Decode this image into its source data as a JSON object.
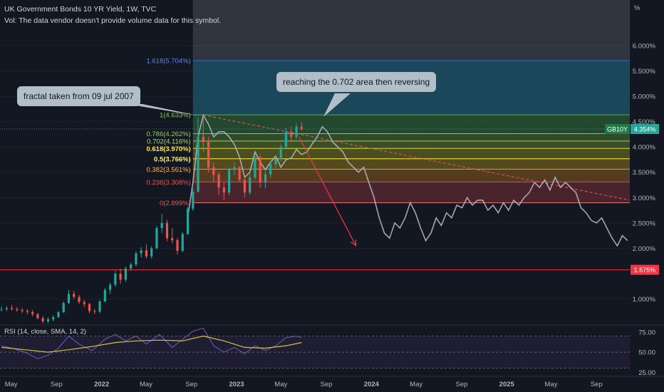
{
  "header": {
    "title": "UK Government Bonds 10 YR Yield, 1W, TVC",
    "volume_note": "Vol: The data vendor doesn't provide volume data for this symbol."
  },
  "callouts": {
    "fractal": "fractal taken from 09 jul 2007",
    "reaching": "reaching the 0.702 area then reversing"
  },
  "colors": {
    "background": "#131722",
    "up_candle": "#26a69a",
    "down_candle": "#ef5350",
    "projection": "#b2b5be",
    "rsi_line": "#7e57c2",
    "rsi_ma": "#d4c43a"
  },
  "chart_data": {
    "type": "candlestick",
    "symbol_badge": "GB10Y",
    "price_axis": {
      "unit": "%",
      "ticks": [
        "6.000%",
        "5.500%",
        "5.000%",
        "4.500%",
        "4.000%",
        "3.500%",
        "3.000%",
        "2.500%",
        "2.000%",
        "1.000%"
      ],
      "tick_values": [
        6.0,
        5.5,
        5.0,
        4.5,
        4.0,
        3.5,
        3.0,
        2.5,
        2.0,
        1.0
      ],
      "range": [
        0.5,
        6.9
      ]
    },
    "time_axis": {
      "labels": [
        "May",
        "Sep",
        "2022",
        "May",
        "Sep",
        "2023",
        "May",
        "Sep",
        "2024",
        "May",
        "Sep",
        "2025",
        "May",
        "Sep"
      ],
      "range": [
        "2021-04-01",
        "2025-11-30"
      ]
    },
    "current_price": {
      "label": "4.354%",
      "value": 4.354
    },
    "horizontal_line": {
      "label": "1.575%",
      "value": 1.575
    },
    "fib_levels": [
      {
        "label": "1.618(5.704%)",
        "ratio": 1.618,
        "value": 5.704,
        "color": "#2962ff",
        "text_color": "#5b86e5",
        "fill": "#1e5a6e"
      },
      {
        "label": "1(4.633%)",
        "ratio": 1,
        "value": 4.633,
        "color": "#4caf50",
        "text_color": "#8bc34a",
        "fill": "#2a5a34"
      },
      {
        "label": "0.786(4.262%)",
        "ratio": 0.786,
        "value": 4.262,
        "color": "#81c784",
        "text_color": "#9ccc65",
        "fill": "#3a5f2c"
      },
      {
        "label": "0.702(4.116%)",
        "ratio": 0.702,
        "value": 4.116,
        "color": "#9ccc65",
        "text_color": "#aed581",
        "fill": "#4d6226"
      },
      {
        "label": "0.618(3.970%)",
        "ratio": 0.618,
        "value": 3.97,
        "color": "#cddc39",
        "text_color": "#ffeb3b",
        "fill": "#5f6220"
      },
      {
        "label": "0.5(3.766%)",
        "ratio": 0.5,
        "value": 3.766,
        "color": "#ffeb3b",
        "text_color": "#fff176",
        "fill": "#6a5e1e"
      },
      {
        "label": "0.382(3.561%)",
        "ratio": 0.382,
        "value": 3.561,
        "color": "#ff9800",
        "text_color": "#ffb74d",
        "fill": "#6b4a22"
      },
      {
        "label": "0.236(3.308%)",
        "ratio": 0.236,
        "value": 3.308,
        "color": "#f44336",
        "text_color": "#ef5350",
        "fill": "#5e2a30"
      },
      {
        "label": "0(2.899%)",
        "ratio": 0,
        "value": 2.899,
        "color": "#e57373",
        "text_color": "#ef5350",
        "fill": ""
      }
    ],
    "fib_range": [
      "2022-09-05",
      "2025-11-30"
    ],
    "candles": [
      {
        "t": "2021-04-05",
        "o": 0.8,
        "h": 0.85,
        "l": 0.75,
        "c": 0.8
      },
      {
        "t": "2021-04-19",
        "o": 0.8,
        "h": 0.86,
        "l": 0.76,
        "c": 0.82
      },
      {
        "t": "2021-05-03",
        "o": 0.82,
        "h": 0.88,
        "l": 0.77,
        "c": 0.8
      },
      {
        "t": "2021-05-17",
        "o": 0.8,
        "h": 0.84,
        "l": 0.75,
        "c": 0.78
      },
      {
        "t": "2021-05-31",
        "o": 0.78,
        "h": 0.82,
        "l": 0.72,
        "c": 0.76
      },
      {
        "t": "2021-06-14",
        "o": 0.76,
        "h": 0.8,
        "l": 0.7,
        "c": 0.74
      },
      {
        "t": "2021-06-28",
        "o": 0.74,
        "h": 0.78,
        "l": 0.66,
        "c": 0.7
      },
      {
        "t": "2021-07-12",
        "o": 0.7,
        "h": 0.72,
        "l": 0.6,
        "c": 0.62
      },
      {
        "t": "2021-07-26",
        "o": 0.62,
        "h": 0.66,
        "l": 0.52,
        "c": 0.56
      },
      {
        "t": "2021-08-09",
        "o": 0.56,
        "h": 0.64,
        "l": 0.52,
        "c": 0.6
      },
      {
        "t": "2021-08-23",
        "o": 0.6,
        "h": 0.68,
        "l": 0.56,
        "c": 0.64
      },
      {
        "t": "2021-09-06",
        "o": 0.64,
        "h": 0.76,
        "l": 0.62,
        "c": 0.74
      },
      {
        "t": "2021-09-20",
        "o": 0.74,
        "h": 0.95,
        "l": 0.72,
        "c": 0.92
      },
      {
        "t": "2021-10-04",
        "o": 0.92,
        "h": 1.18,
        "l": 0.9,
        "c": 1.1
      },
      {
        "t": "2021-10-18",
        "o": 1.1,
        "h": 1.16,
        "l": 1.0,
        "c": 1.04
      },
      {
        "t": "2021-11-01",
        "o": 1.04,
        "h": 1.08,
        "l": 0.9,
        "c": 0.94
      },
      {
        "t": "2021-11-15",
        "o": 0.94,
        "h": 0.98,
        "l": 0.84,
        "c": 0.9
      },
      {
        "t": "2021-11-29",
        "o": 0.9,
        "h": 0.92,
        "l": 0.72,
        "c": 0.76
      },
      {
        "t": "2021-12-13",
        "o": 0.76,
        "h": 0.8,
        "l": 0.7,
        "c": 0.75
      },
      {
        "t": "2021-12-27",
        "o": 0.75,
        "h": 0.98,
        "l": 0.72,
        "c": 0.95
      },
      {
        "t": "2022-01-10",
        "o": 0.95,
        "h": 1.22,
        "l": 0.94,
        "c": 1.18
      },
      {
        "t": "2022-01-24",
        "o": 1.18,
        "h": 1.32,
        "l": 1.1,
        "c": 1.28
      },
      {
        "t": "2022-02-07",
        "o": 1.28,
        "h": 1.56,
        "l": 1.24,
        "c": 1.5
      },
      {
        "t": "2022-02-21",
        "o": 1.5,
        "h": 1.6,
        "l": 1.3,
        "c": 1.38
      },
      {
        "t": "2022-03-07",
        "o": 1.38,
        "h": 1.64,
        "l": 1.34,
        "c": 1.6
      },
      {
        "t": "2022-03-21",
        "o": 1.6,
        "h": 1.72,
        "l": 1.56,
        "c": 1.68
      },
      {
        "t": "2022-04-04",
        "o": 1.68,
        "h": 1.94,
        "l": 1.64,
        "c": 1.9
      },
      {
        "t": "2022-04-18",
        "o": 1.9,
        "h": 2.02,
        "l": 1.82,
        "c": 1.96
      },
      {
        "t": "2022-05-02",
        "o": 1.96,
        "h": 2.08,
        "l": 1.8,
        "c": 1.84
      },
      {
        "t": "2022-05-16",
        "o": 1.84,
        "h": 2.04,
        "l": 1.8,
        "c": 2.0
      },
      {
        "t": "2022-05-30",
        "o": 2.0,
        "h": 2.44,
        "l": 1.98,
        "c": 2.4
      },
      {
        "t": "2022-06-13",
        "o": 2.4,
        "h": 2.68,
        "l": 2.3,
        "c": 2.5
      },
      {
        "t": "2022-06-27",
        "o": 2.5,
        "h": 2.56,
        "l": 2.14,
        "c": 2.2
      },
      {
        "t": "2022-07-11",
        "o": 2.2,
        "h": 2.4,
        "l": 2.1,
        "c": 2.16
      },
      {
        "t": "2022-07-25",
        "o": 2.16,
        "h": 2.2,
        "l": 1.88,
        "c": 1.95
      },
      {
        "t": "2022-08-08",
        "o": 1.95,
        "h": 2.32,
        "l": 1.92,
        "c": 2.28
      },
      {
        "t": "2022-08-22",
        "o": 2.28,
        "h": 2.82,
        "l": 2.26,
        "c": 2.78
      },
      {
        "t": "2022-09-05",
        "o": 2.78,
        "h": 3.18,
        "l": 2.74,
        "c": 3.12
      },
      {
        "t": "2022-09-19",
        "o": 3.12,
        "h": 4.58,
        "l": 3.1,
        "c": 4.2
      },
      {
        "t": "2022-10-03",
        "o": 4.2,
        "h": 4.63,
        "l": 3.9,
        "c": 4.1
      },
      {
        "t": "2022-10-17",
        "o": 4.1,
        "h": 4.2,
        "l": 3.5,
        "c": 3.6
      },
      {
        "t": "2022-10-31",
        "o": 3.6,
        "h": 3.7,
        "l": 3.3,
        "c": 3.45
      },
      {
        "t": "2022-11-14",
        "o": 3.45,
        "h": 3.5,
        "l": 3.05,
        "c": 3.2
      },
      {
        "t": "2022-11-28",
        "o": 3.2,
        "h": 3.3,
        "l": 2.95,
        "c": 3.1
      },
      {
        "t": "2022-12-12",
        "o": 3.1,
        "h": 3.6,
        "l": 3.05,
        "c": 3.55
      },
      {
        "t": "2022-12-26",
        "o": 3.55,
        "h": 3.7,
        "l": 3.45,
        "c": 3.6
      },
      {
        "t": "2023-01-09",
        "o": 3.6,
        "h": 3.62,
        "l": 3.3,
        "c": 3.35
      },
      {
        "t": "2023-01-23",
        "o": 3.35,
        "h": 3.42,
        "l": 3.0,
        "c": 3.1
      },
      {
        "t": "2023-02-06",
        "o": 3.1,
        "h": 3.5,
        "l": 3.05,
        "c": 3.4
      },
      {
        "t": "2023-02-20",
        "o": 3.4,
        "h": 3.82,
        "l": 3.36,
        "c": 3.8
      },
      {
        "t": "2023-03-06",
        "o": 3.8,
        "h": 3.84,
        "l": 3.2,
        "c": 3.3
      },
      {
        "t": "2023-03-20",
        "o": 3.3,
        "h": 3.52,
        "l": 3.18,
        "c": 3.46
      },
      {
        "t": "2023-04-03",
        "o": 3.46,
        "h": 3.72,
        "l": 3.4,
        "c": 3.66
      },
      {
        "t": "2023-04-17",
        "o": 3.66,
        "h": 3.82,
        "l": 3.6,
        "c": 3.76
      },
      {
        "t": "2023-05-01",
        "o": 3.76,
        "h": 4.05,
        "l": 3.72,
        "c": 4.0
      },
      {
        "t": "2023-05-15",
        "o": 4.0,
        "h": 4.38,
        "l": 3.98,
        "c": 4.3
      },
      {
        "t": "2023-05-29",
        "o": 4.3,
        "h": 4.4,
        "l": 4.1,
        "c": 4.2
      },
      {
        "t": "2023-06-12",
        "o": 4.2,
        "h": 4.46,
        "l": 4.16,
        "c": 4.4
      },
      {
        "t": "2023-06-26",
        "o": 4.4,
        "h": 4.48,
        "l": 4.32,
        "c": 4.354
      }
    ],
    "fractal_projection": [
      {
        "t": "2022-08-22",
        "v": 2.6
      },
      {
        "t": "2022-09-05",
        "v": 3.3
      },
      {
        "t": "2022-09-19",
        "v": 4.2
      },
      {
        "t": "2022-10-03",
        "v": 4.63
      },
      {
        "t": "2022-10-17",
        "v": 4.45
      },
      {
        "t": "2022-10-31",
        "v": 4.2
      },
      {
        "t": "2022-11-14",
        "v": 4.3
      },
      {
        "t": "2022-11-28",
        "v": 4.3
      },
      {
        "t": "2022-12-12",
        "v": 4.2
      },
      {
        "t": "2022-12-26",
        "v": 4.05
      },
      {
        "t": "2023-01-09",
        "v": 3.8
      },
      {
        "t": "2023-01-23",
        "v": 3.4
      },
      {
        "t": "2023-02-06",
        "v": 3.5
      },
      {
        "t": "2023-02-20",
        "v": 3.9
      },
      {
        "t": "2023-03-06",
        "v": 3.7
      },
      {
        "t": "2023-03-20",
        "v": 3.55
      },
      {
        "t": "2023-04-03",
        "v": 3.7
      },
      {
        "t": "2023-04-17",
        "v": 3.82
      },
      {
        "t": "2023-05-01",
        "v": 3.6
      },
      {
        "t": "2023-05-15",
        "v": 3.75
      },
      {
        "t": "2023-05-29",
        "v": 3.78
      },
      {
        "t": "2023-06-12",
        "v": 3.95
      },
      {
        "t": "2023-06-26",
        "v": 3.85
      },
      {
        "t": "2023-07-10",
        "v": 3.9
      },
      {
        "t": "2023-07-24",
        "v": 4.05
      },
      {
        "t": "2023-08-07",
        "v": 4.2
      },
      {
        "t": "2023-08-21",
        "v": 4.4
      },
      {
        "t": "2023-09-04",
        "v": 4.3
      },
      {
        "t": "2023-09-18",
        "v": 4.1
      },
      {
        "t": "2023-10-02",
        "v": 4.0
      },
      {
        "t": "2023-10-16",
        "v": 3.9
      },
      {
        "t": "2023-10-30",
        "v": 3.7
      },
      {
        "t": "2023-11-13",
        "v": 3.6
      },
      {
        "t": "2023-11-27",
        "v": 3.5
      },
      {
        "t": "2023-12-11",
        "v": 3.6
      },
      {
        "t": "2023-12-25",
        "v": 3.3
      },
      {
        "t": "2024-01-08",
        "v": 3.0
      },
      {
        "t": "2024-01-22",
        "v": 2.6
      },
      {
        "t": "2024-02-05",
        "v": 2.3
      },
      {
        "t": "2024-02-19",
        "v": 2.2
      },
      {
        "t": "2024-03-04",
        "v": 2.5
      },
      {
        "t": "2024-03-18",
        "v": 2.4
      },
      {
        "t": "2024-04-01",
        "v": 2.6
      },
      {
        "t": "2024-04-15",
        "v": 2.9
      },
      {
        "t": "2024-04-29",
        "v": 2.7
      },
      {
        "t": "2024-05-13",
        "v": 2.4
      },
      {
        "t": "2024-05-27",
        "v": 2.15
      },
      {
        "t": "2024-06-10",
        "v": 2.3
      },
      {
        "t": "2024-06-24",
        "v": 2.6
      },
      {
        "t": "2024-07-08",
        "v": 2.45
      },
      {
        "t": "2024-07-22",
        "v": 2.7
      },
      {
        "t": "2024-08-05",
        "v": 2.6
      },
      {
        "t": "2024-08-19",
        "v": 2.85
      },
      {
        "t": "2024-09-02",
        "v": 2.8
      },
      {
        "t": "2024-09-16",
        "v": 3.0
      },
      {
        "t": "2024-09-30",
        "v": 2.85
      },
      {
        "t": "2024-10-14",
        "v": 2.95
      },
      {
        "t": "2024-10-28",
        "v": 2.95
      },
      {
        "t": "2024-11-11",
        "v": 2.75
      },
      {
        "t": "2024-11-25",
        "v": 2.85
      },
      {
        "t": "2024-12-09",
        "v": 2.7
      },
      {
        "t": "2024-12-23",
        "v": 2.9
      },
      {
        "t": "2025-01-06",
        "v": 2.75
      },
      {
        "t": "2025-01-20",
        "v": 2.95
      },
      {
        "t": "2025-02-03",
        "v": 2.85
      },
      {
        "t": "2025-02-17",
        "v": 3.0
      },
      {
        "t": "2025-03-03",
        "v": 3.1
      },
      {
        "t": "2025-03-17",
        "v": 3.3
      },
      {
        "t": "2025-03-31",
        "v": 3.2
      },
      {
        "t": "2025-04-14",
        "v": 3.35
      },
      {
        "t": "2025-04-28",
        "v": 3.15
      },
      {
        "t": "2025-05-12",
        "v": 3.4
      },
      {
        "t": "2025-05-26",
        "v": 3.2
      },
      {
        "t": "2025-06-09",
        "v": 3.3
      },
      {
        "t": "2025-06-23",
        "v": 3.2
      },
      {
        "t": "2025-07-07",
        "v": 3.1
      },
      {
        "t": "2025-07-21",
        "v": 2.8
      },
      {
        "t": "2025-08-04",
        "v": 2.7
      },
      {
        "t": "2025-08-18",
        "v": 2.55
      },
      {
        "t": "2025-09-01",
        "v": 2.5
      },
      {
        "t": "2025-09-15",
        "v": 2.6
      },
      {
        "t": "2025-09-29",
        "v": 2.4
      },
      {
        "t": "2025-10-13",
        "v": 2.2
      },
      {
        "t": "2025-10-27",
        "v": 2.05
      },
      {
        "t": "2025-11-10",
        "v": 2.25
      },
      {
        "t": "2025-11-24",
        "v": 2.15
      }
    ],
    "trendline": [
      {
        "t": "2022-10-03",
        "v": 4.63
      },
      {
        "t": "2025-11-30",
        "v": 2.95
      }
    ],
    "arrow": [
      {
        "t": "2023-06-19",
        "v": 4.2
      },
      {
        "t": "2023-11-20",
        "v": 2.05
      }
    ],
    "rsi": {
      "label": "RSI (14, close, SMA, 14, 2)",
      "ticks": [
        "75.00",
        "50.00",
        "25.00"
      ],
      "tick_values": [
        75,
        50,
        25
      ],
      "range": [
        20,
        82
      ],
      "band": [
        30,
        70
      ],
      "rsi_values": [
        {
          "t": "2021-04-05",
          "v": 58
        },
        {
          "t": "2021-05-03",
          "v": 55
        },
        {
          "t": "2021-06-07",
          "v": 50
        },
        {
          "t": "2021-07-12",
          "v": 42
        },
        {
          "t": "2021-08-09",
          "v": 46
        },
        {
          "t": "2021-09-06",
          "v": 55
        },
        {
          "t": "2021-10-04",
          "v": 70
        },
        {
          "t": "2021-11-01",
          "v": 60
        },
        {
          "t": "2021-12-06",
          "v": 52
        },
        {
          "t": "2022-01-10",
          "v": 66
        },
        {
          "t": "2022-02-07",
          "v": 72
        },
        {
          "t": "2022-03-07",
          "v": 64
        },
        {
          "t": "2022-04-04",
          "v": 70
        },
        {
          "t": "2022-05-02",
          "v": 60
        },
        {
          "t": "2022-06-06",
          "v": 72
        },
        {
          "t": "2022-07-11",
          "v": 56
        },
        {
          "t": "2022-08-08",
          "v": 66
        },
        {
          "t": "2022-09-05",
          "v": 76
        },
        {
          "t": "2022-10-03",
          "v": 80
        },
        {
          "t": "2022-10-31",
          "v": 58
        },
        {
          "t": "2022-11-28",
          "v": 50
        },
        {
          "t": "2022-12-26",
          "v": 56
        },
        {
          "t": "2023-01-23",
          "v": 48
        },
        {
          "t": "2023-02-20",
          "v": 58
        },
        {
          "t": "2023-03-20",
          "v": 52
        },
        {
          "t": "2023-04-17",
          "v": 58
        },
        {
          "t": "2023-05-15",
          "v": 68
        },
        {
          "t": "2023-06-12",
          "v": 70
        },
        {
          "t": "2023-06-26",
          "v": 68
        }
      ],
      "ma_values": [
        {
          "t": "2021-04-05",
          "v": 56
        },
        {
          "t": "2021-06-07",
          "v": 53
        },
        {
          "t": "2021-08-09",
          "v": 50
        },
        {
          "t": "2021-10-04",
          "v": 53
        },
        {
          "t": "2021-12-06",
          "v": 57
        },
        {
          "t": "2022-02-07",
          "v": 62
        },
        {
          "t": "2022-04-04",
          "v": 64
        },
        {
          "t": "2022-06-06",
          "v": 65
        },
        {
          "t": "2022-08-08",
          "v": 64
        },
        {
          "t": "2022-10-03",
          "v": 70
        },
        {
          "t": "2022-11-28",
          "v": 64
        },
        {
          "t": "2023-01-23",
          "v": 56
        },
        {
          "t": "2023-03-20",
          "v": 55
        },
        {
          "t": "2023-05-15",
          "v": 58
        },
        {
          "t": "2023-06-26",
          "v": 62
        }
      ]
    }
  }
}
